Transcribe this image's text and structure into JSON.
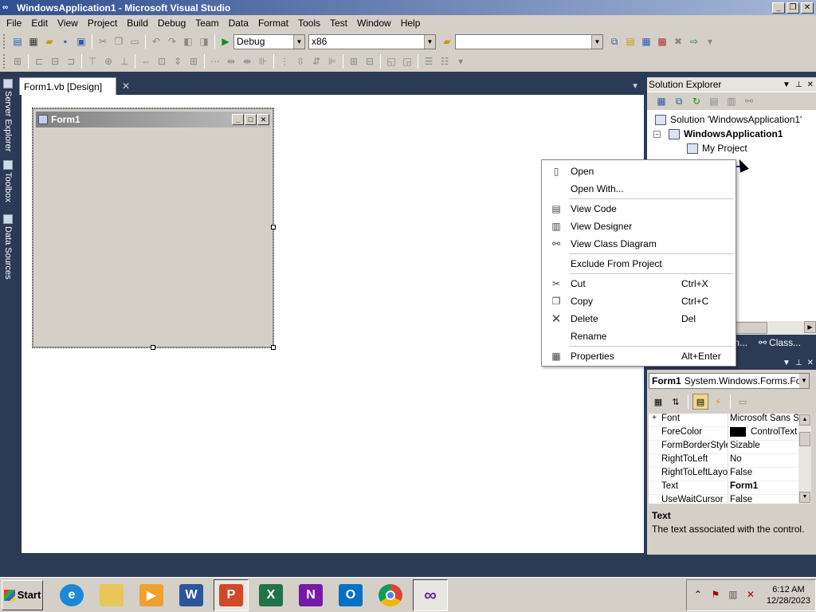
{
  "window": {
    "title": "WindowsApplication1 - Microsoft Visual Studio",
    "min": "_",
    "max": "❐",
    "close": "✕"
  },
  "menu": [
    "File",
    "Edit",
    "View",
    "Project",
    "Build",
    "Debug",
    "Team",
    "Data",
    "Format",
    "Tools",
    "Test",
    "Window",
    "Help"
  ],
  "toolbar": {
    "config": "Debug",
    "platform": "x86",
    "find": ""
  },
  "left_tabs": [
    "Server Explorer",
    "Toolbox",
    "Data Sources"
  ],
  "document": {
    "tab_label": "Form1.vb [Design]",
    "form_title": "Form1"
  },
  "solution_explorer": {
    "title": "Solution Explorer",
    "solution": "Solution 'WindowsApplication1'",
    "project": "WindowsApplication1",
    "selected_item": "My Project",
    "bottom_tabs": [
      "m...",
      "Class..."
    ]
  },
  "context_menu": {
    "items": [
      {
        "label": "Open",
        "shortcut": "",
        "icon": "open-icon"
      },
      {
        "label": "Open With...",
        "shortcut": "",
        "icon": ""
      },
      {
        "label": "View Code",
        "shortcut": "",
        "icon": "view-code-icon"
      },
      {
        "label": "View Designer",
        "shortcut": "",
        "icon": "view-designer-icon"
      },
      {
        "label": "View Class Diagram",
        "shortcut": "",
        "icon": "class-diagram-icon"
      },
      {
        "label": "Exclude From Project",
        "shortcut": "",
        "icon": ""
      },
      {
        "label": "Cut",
        "shortcut": "Ctrl+X",
        "icon": "scissors-icon"
      },
      {
        "label": "Copy",
        "shortcut": "Ctrl+C",
        "icon": "copy-icon"
      },
      {
        "label": "Delete",
        "shortcut": "Del",
        "icon": "delete-x-icon"
      },
      {
        "label": "Rename",
        "shortcut": "",
        "icon": ""
      },
      {
        "label": "Properties",
        "shortcut": "Alt+Enter",
        "icon": "properties-icon"
      }
    ]
  },
  "properties": {
    "object_name": "Form1",
    "object_type": "System.Windows.Forms.Form",
    "rows": [
      {
        "name": "Font",
        "value": "Microsoft Sans Se",
        "expand": "+"
      },
      {
        "name": "ForeColor",
        "value": "ControlText",
        "expand": ""
      },
      {
        "name": "FormBorderStyle",
        "value": "Sizable",
        "expand": ""
      },
      {
        "name": "RightToLeft",
        "value": "No",
        "expand": ""
      },
      {
        "name": "RightToLeftLayo",
        "value": "False",
        "expand": ""
      },
      {
        "name": "Text",
        "value": "Form1",
        "expand": ""
      },
      {
        "name": "UseWaitCursor",
        "value": "False",
        "expand": ""
      }
    ],
    "desc_title": "Text",
    "desc_text": "The text associated with the control.",
    "forecolor_swatch": "#000000"
  },
  "taskbar": {
    "start": "Start",
    "apps": [
      "edge",
      "file-explorer",
      "media-player",
      "word",
      "powerpoint",
      "excel",
      "onenote",
      "outlook",
      "chrome",
      "visual-studio"
    ],
    "time": "6:12 AM",
    "date": "12/28/2023"
  }
}
